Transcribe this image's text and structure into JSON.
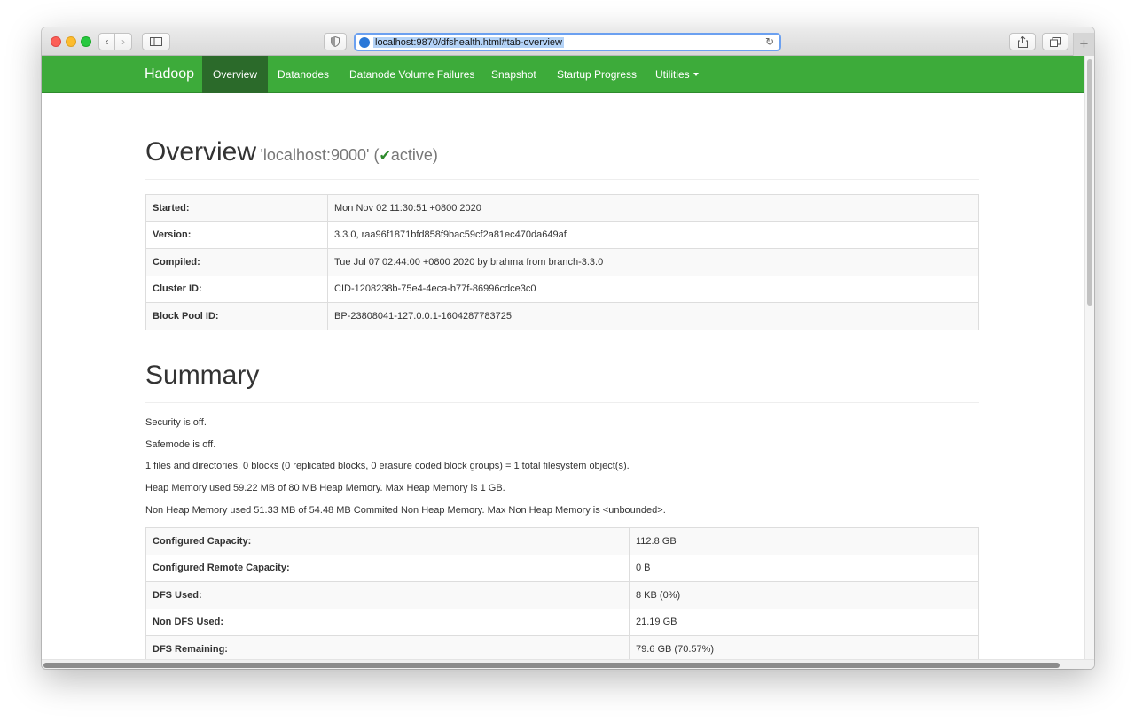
{
  "browser": {
    "url": "localhost:9870/dfshealth.html#tab-overview",
    "buttons": {
      "back": "‹",
      "forward": "›",
      "new_tab": "+"
    }
  },
  "navbar": {
    "brand": "Hadoop",
    "items": [
      {
        "label": "Overview",
        "active": true
      },
      {
        "label": "Datanodes"
      },
      {
        "label": "Datanode Volume Failures"
      },
      {
        "label": "Snapshot"
      },
      {
        "label": "Startup Progress"
      },
      {
        "label": "Utilities"
      }
    ],
    "color": "#3dab3a"
  },
  "overview": {
    "title": "Overview",
    "host": "'localhost:9000' (",
    "check": "✔",
    "state": "active)",
    "rows": [
      {
        "key": "Started:",
        "value": "Mon Nov 02 11:30:51 +0800 2020"
      },
      {
        "key": "Version:",
        "value": "3.3.0, raa96f1871bfd858f9bac59cf2a81ec470da649af"
      },
      {
        "key": "Compiled:",
        "value": "Tue Jul 07 02:44:00 +0800 2020 by brahma from branch-3.3.0"
      },
      {
        "key": "Cluster ID:",
        "value": "CID-1208238b-75e4-4eca-b77f-86996cdce3c0"
      },
      {
        "key": "Block Pool ID:",
        "value": "BP-23808041-127.0.0.1-1604287783725"
      }
    ]
  },
  "summary": {
    "title": "Summary",
    "lines": [
      "Security is off.",
      "Safemode is off.",
      "1 files and directories, 0 blocks (0 replicated blocks, 0 erasure coded block groups) = 1 total filesystem object(s).",
      "Heap Memory used 59.22 MB of 80 MB Heap Memory. Max Heap Memory is 1 GB.",
      "Non Heap Memory used 51.33 MB of 54.48 MB Commited Non Heap Memory. Max Non Heap Memory is <unbounded>."
    ],
    "rows": [
      {
        "key": "Configured Capacity:",
        "value": "112.8 GB"
      },
      {
        "key": "Configured Remote Capacity:",
        "value": "0 B"
      },
      {
        "key": "DFS Used:",
        "value": "8 KB (0%)"
      },
      {
        "key": "Non DFS Used:",
        "value": "21.19 GB"
      },
      {
        "key": "DFS Remaining:",
        "value": "79.6 GB (70.57%)"
      }
    ]
  }
}
